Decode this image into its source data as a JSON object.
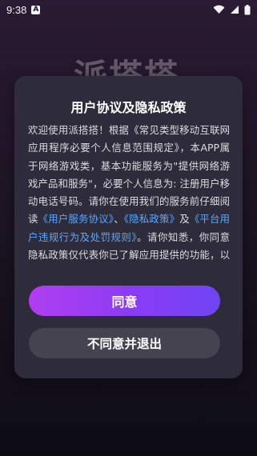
{
  "status_bar": {
    "time": "9:38",
    "app_icon_letter": "A"
  },
  "background": {
    "logo_text": "派搭搭"
  },
  "dialog": {
    "title": "用户协议及隐私政策",
    "body_parts": [
      "欢迎使用派搭搭！根据《常见类型移动互联网应用程序必要个人信息范围规定》，本APP属于网络游戏类，基本功能服务为\"提供网络游戏产品和服务\"，必要个人信息为: 注册用户移动电话号码。请你在使用我们的服务前仔细阅读",
      "《用户服务协议》",
      "、",
      "《隐私政策》",
      "及",
      "《平台用户违规行为及处罚规则》",
      "。请你知悉，你同意隐私政策仅代表你已了解应用提供的功能，以及功能运行所需的必要个人信息，并不代表"
    ],
    "agree_label": "同意",
    "decline_label": "不同意并退出"
  },
  "colors": {
    "link": "#5aa7ff",
    "dialog_bg": "#2e2c3a",
    "agree_gradient_start": "#b03ef0",
    "agree_gradient_end": "#6f45f4",
    "decline_bg": "#454350"
  }
}
